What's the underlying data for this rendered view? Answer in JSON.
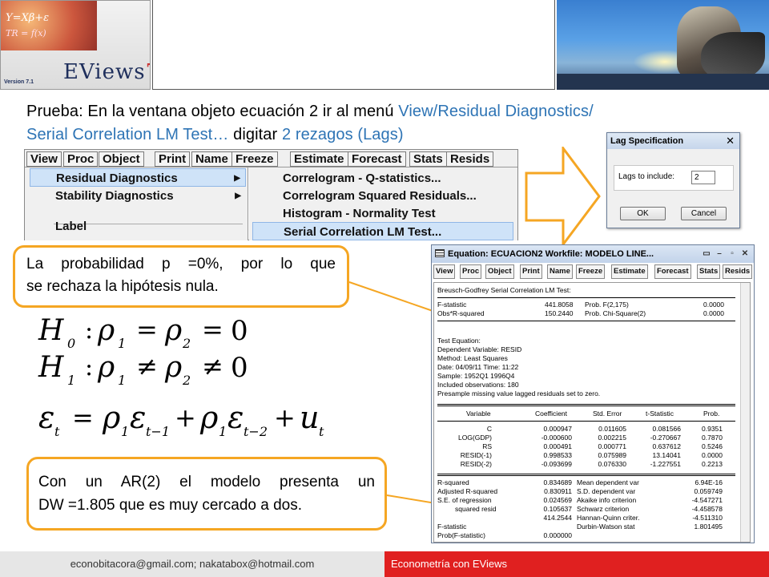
{
  "logo": {
    "formula_top": "Y=Xβ+ε",
    "formula_bottom": "TR = f(x)",
    "brand": "EViews",
    "brand_num": "7",
    "version": "Version 7.1"
  },
  "instruction": {
    "line1_black": "Prueba: En la ventana objeto ecuación 2 ir al menú ",
    "line1_blue": "View/Residual Diagnostics/",
    "line2_blue": "Serial Correlation LM Test…",
    "line2_black": " digitar ",
    "line2_blue2": " 2 rezagos (Lags)"
  },
  "menubar": {
    "items": [
      "View",
      "Proc",
      "Object",
      "Print",
      "Name",
      "Freeze",
      "Estimate",
      "Forecast",
      "Stats",
      "Resids"
    ]
  },
  "view_menu": {
    "items": [
      "Residual Diagnostics",
      "Stability Diagnostics",
      "Label"
    ],
    "arrow": "▶"
  },
  "submenu": {
    "items": [
      "Correlogram - Q-statistics...",
      "Correlogram Squared Residuals...",
      "Histogram - Normality Test",
      "Serial Correlation LM Test..."
    ]
  },
  "lag_dialog": {
    "title": "Lag Specification",
    "close": "✕",
    "label": "Lags to include:",
    "value": "2",
    "ok": "OK",
    "cancel": "Cancel"
  },
  "callout1": {
    "line1": "La probabilidad p =0%, por lo que",
    "line2": "se rechaza la hipótesis nula."
  },
  "callout2": {
    "line1": "Con un AR(2) el modelo presenta un",
    "line2": "DW =1.805 que es muy cercado a dos.",
    "dw_label": "DW"
  },
  "equation_window": {
    "title": "Equation: ECUACION2   Workfile: MODELO LINE...",
    "win_controls": [
      "▭",
      "–",
      "▫",
      "✕"
    ],
    "toolbar": [
      "View",
      "Proc",
      "Object",
      "Print",
      "Name",
      "Freeze",
      "Estimate",
      "Forecast",
      "Stats",
      "Resids"
    ],
    "heading": "Breusch-Godfrey Serial Correlation LM Test:",
    "tests": [
      {
        "name": "F-statistic",
        "value": "441.8058",
        "plabel": "Prob. F(2,175)",
        "pvalue": "0.0000"
      },
      {
        "name": "Obs*R-squared",
        "value": "150.2440",
        "plabel": "Prob. Chi-Square(2)",
        "pvalue": "0.0000"
      }
    ],
    "info": [
      "Test Equation:",
      "Dependent Variable: RESID",
      "Method: Least Squares",
      "Date: 04/09/11   Time: 11:22",
      "Sample: 1952Q1 1996Q4",
      "Included observations: 180",
      "Presample missing value lagged residuals set to zero."
    ],
    "coef_headers": [
      "Variable",
      "Coefficient",
      "Std. Error",
      "t-Statistic",
      "Prob."
    ],
    "coef_rows": [
      [
        "C",
        "0.000947",
        "0.011605",
        "0.081566",
        "0.9351"
      ],
      [
        "LOG(GDP)",
        "-0.000600",
        "0.002215",
        "-0.270667",
        "0.7870"
      ],
      [
        "RS",
        "0.000491",
        "0.000771",
        "0.637612",
        "0.5246"
      ],
      [
        "RESID(-1)",
        "0.998533",
        "0.075989",
        "13.14041",
        "0.0000"
      ],
      [
        "RESID(-2)",
        "-0.093699",
        "0.076330",
        "-1.227551",
        "0.2213"
      ]
    ],
    "stats_rows": [
      [
        "R-squared",
        "0.834689",
        "Mean dependent var",
        "6.94E-16"
      ],
      [
        "Adjusted R-squared",
        "0.830911",
        "S.D. dependent var",
        "0.059749"
      ],
      [
        "S.E. of regression",
        "0.024569",
        "Akaike info criterion",
        "-4.547271"
      ],
      [
        "squared resid",
        "0.105637",
        "Schwarz criterion",
        "-4.458578"
      ],
      [
        "",
        "414.2544",
        "Hannan-Quinn criter.",
        "-4.511310"
      ],
      [
        "F-statistic",
        "",
        "Durbin-Watson stat",
        "1.801495"
      ],
      [
        "Prob(F-statistic)",
        "0.000000",
        "",
        ""
      ]
    ]
  },
  "math": {
    "h0": {
      "H": "H",
      "sub": "0",
      "colon": ":",
      "rho": "ρ",
      "s1": "1",
      "eq1": "=",
      "s2": "2",
      "eq2": "=",
      "zero": "0"
    },
    "h1": {
      "H": "H",
      "sub": "1",
      "colon": ":",
      "rho": "ρ",
      "s1": "1",
      "ne1": "≠",
      "s2": "2",
      "ne2": "≠",
      "zero": "0"
    },
    "model": {
      "eps": "ε",
      "t": "t",
      "eq": "=",
      "rho": "ρ",
      "one": "1",
      "tm1": "t−1",
      "plus": "+",
      "tm2": "t−2",
      "u": "u"
    }
  },
  "footer": {
    "left": "econobitacora@gmail.com;  nakatabox@hotmail.com",
    "right": "Econometría con EViews"
  },
  "colors": {
    "accent_blue": "#2e74b5",
    "callout_border": "#f5a623",
    "footer_red": "#e02020"
  }
}
